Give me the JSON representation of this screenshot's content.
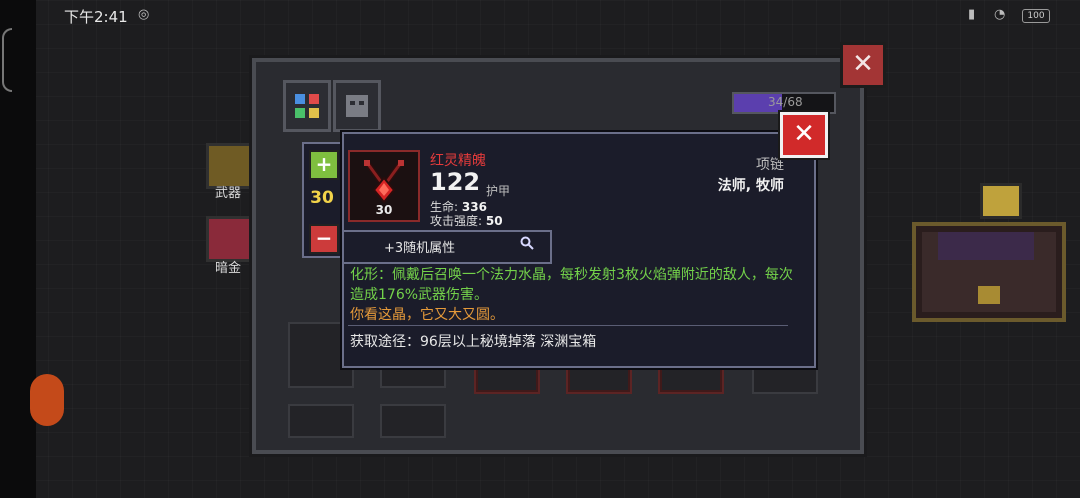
{
  "status_bar": {
    "time": "下午2:41",
    "battery": "100"
  },
  "panel": {
    "close_label": "✕",
    "capacity": "34/68",
    "capacity_fraction": 0.5,
    "side_items": [
      {
        "label": "武器"
      },
      {
        "label": "暗金"
      }
    ]
  },
  "stepper": {
    "plus": "+",
    "minus": "−",
    "value": "30"
  },
  "item": {
    "name": "红灵精魄",
    "level": "30",
    "score": "122",
    "score_label": "护甲",
    "stats": [
      {
        "label": "生命:",
        "value": "336"
      },
      {
        "label": "攻击强度:",
        "value": "50"
      }
    ],
    "type": "项链",
    "classes": "法师, 牧师",
    "random_attr": "+3随机属性",
    "effect": "化形：佩戴后召唤一个法力水晶，每秒发射3枚火焰弹附近的敌人，每次造成176%武器伤害。",
    "flavor": "你看这晶，它又大又圆。",
    "source": "获取途径：96层以上秘境掉落 深渊宝箱"
  },
  "popup": {
    "close_label": "✕"
  },
  "colors": {
    "item_name": "#e33b3b",
    "effect": "#73d14a",
    "flavor": "#e59a3a",
    "stepper_value": "#f2d34a"
  }
}
